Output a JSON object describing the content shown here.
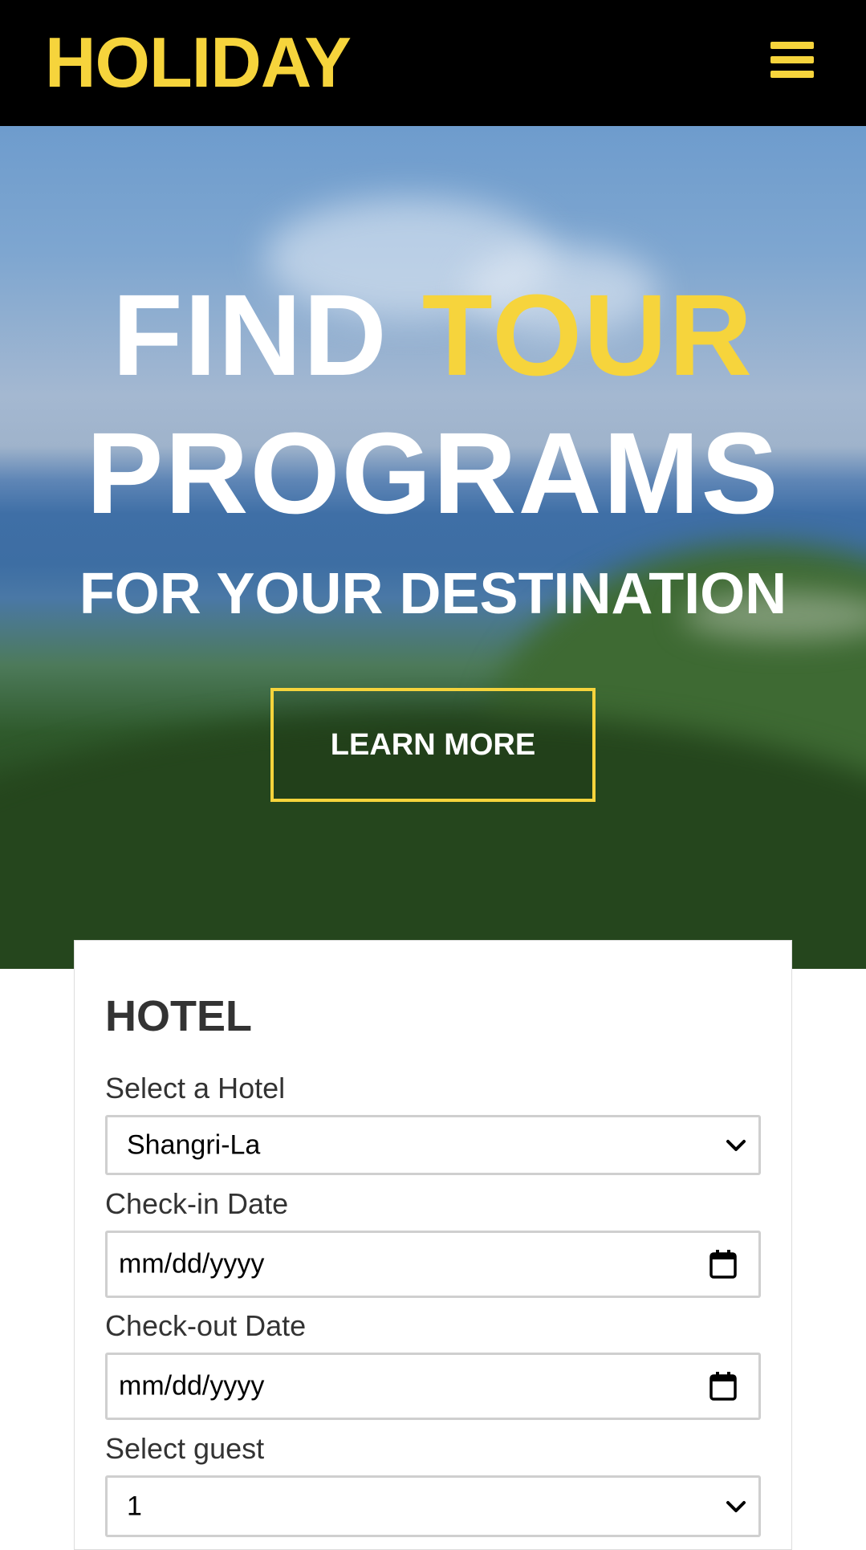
{
  "colors": {
    "accent": "#f6d43c",
    "header_bg": "#000000",
    "text_dark": "#333333",
    "white": "#ffffff",
    "field_border": "#cfcfcf"
  },
  "header": {
    "logo": "HOLIDAY",
    "menu_icon": "hamburger-menu-icon"
  },
  "hero": {
    "title_word_1": "FIND",
    "title_word_2": "TOUR",
    "title_line_2": "PROGRAMS",
    "subtitle": "FOR YOUR DESTINATION",
    "cta_label": "LEARN MORE"
  },
  "hotel_form": {
    "title": "HOTEL",
    "hotel_label": "Select a Hotel",
    "hotel_value": "Shangri-La",
    "checkin_label": "Check-in Date",
    "checkin_placeholder": "mm/dd/yyyy",
    "checkout_label": "Check-out Date",
    "checkout_placeholder": "mm/dd/yyyy",
    "guest_label": "Select guest",
    "guest_value": "1",
    "icons": {
      "select": "chevron-down-icon",
      "date": "calendar-icon"
    }
  }
}
